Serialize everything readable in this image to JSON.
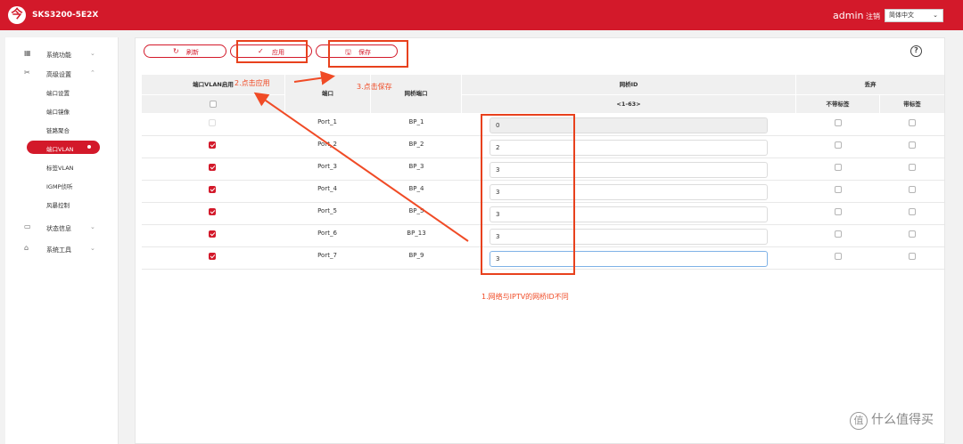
{
  "header": {
    "logo": "今",
    "model": "SKS3200-5E2X",
    "user": "admin",
    "logout": "注销",
    "language": "简体中文"
  },
  "sidebar": {
    "groups": [
      {
        "label": "系统功能",
        "icon": "grid-icon"
      },
      {
        "label": "高级设置",
        "icon": "tools-icon"
      },
      {
        "label": "状态信息",
        "icon": "monitor-icon"
      },
      {
        "label": "系统工具",
        "icon": "briefcase-icon"
      }
    ],
    "sub_items": [
      "端口设置",
      "端口镜像",
      "链路聚合",
      "端口VLAN",
      "标签VLAN",
      "IGMP侦听",
      "风暴控制"
    ],
    "active_index": 3
  },
  "toolbar": {
    "refresh": "刷新",
    "apply": "应用",
    "save": "保存"
  },
  "table": {
    "headers": {
      "enable": "端口VLAN启用",
      "port": "端口",
      "bridge_port": "网桥端口",
      "bridge_id": "网桥ID",
      "range": "<1-63>",
      "discard": "丢弃",
      "untagged": "不带标签",
      "tagged": "带标签"
    },
    "rows": [
      {
        "enabled": false,
        "disabled": true,
        "port": "Port_1",
        "bp": "BP_1",
        "id": "0"
      },
      {
        "enabled": true,
        "disabled": false,
        "port": "Port_2",
        "bp": "BP_2",
        "id": "2"
      },
      {
        "enabled": true,
        "disabled": false,
        "port": "Port_3",
        "bp": "BP_3",
        "id": "3"
      },
      {
        "enabled": true,
        "disabled": false,
        "port": "Port_4",
        "bp": "BP_4",
        "id": "3"
      },
      {
        "enabled": true,
        "disabled": false,
        "port": "Port_5",
        "bp": "BP_5",
        "id": "3"
      },
      {
        "enabled": true,
        "disabled": false,
        "port": "Port_6",
        "bp": "BP_13",
        "id": "3"
      },
      {
        "enabled": true,
        "disabled": false,
        "port": "Port_7",
        "bp": "BP_9",
        "id": "3"
      }
    ]
  },
  "annotations": {
    "step1": "1.网络与IPTV的网桥ID不同",
    "step2": "2.点击应用",
    "step3": "3.点击保存"
  },
  "watermark": "什么值得买",
  "colors": {
    "brand": "#d3192a",
    "annotation": "#f04b26"
  }
}
